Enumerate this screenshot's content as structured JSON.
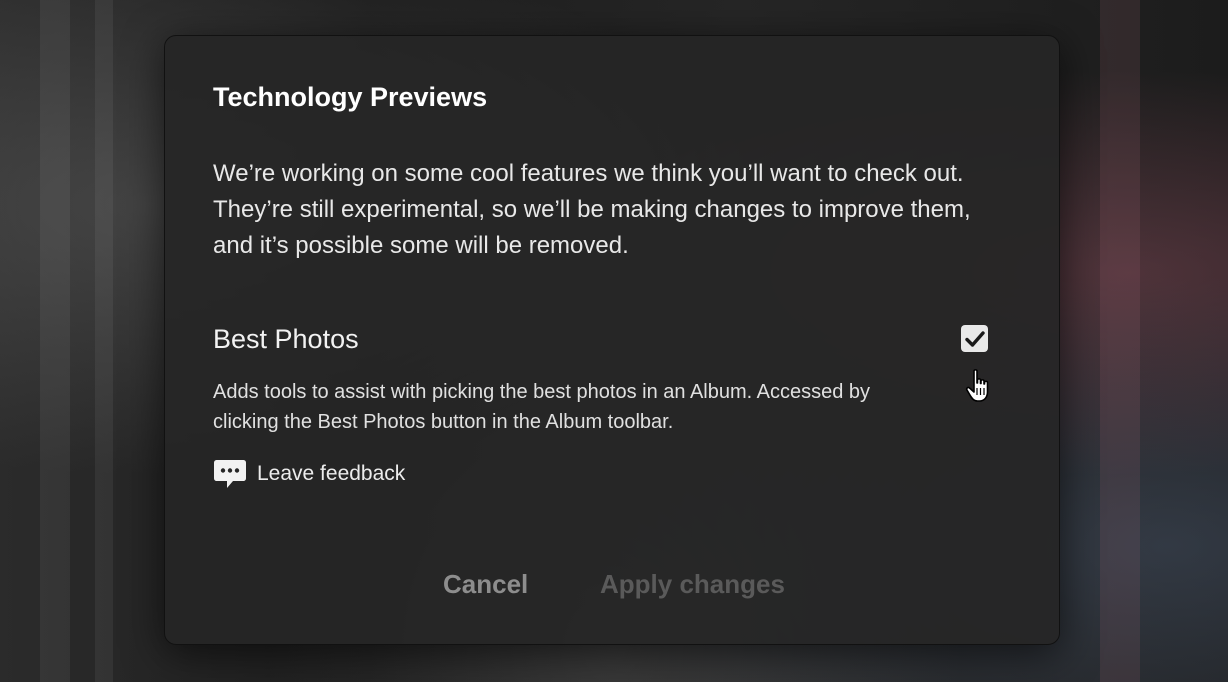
{
  "dialog": {
    "title": "Technology Previews",
    "intro": "We’re working on some cool features we think you’ll want to check out. They’re still experimental, so we’ll be making changes to improve them, and it’s possible some will be removed."
  },
  "feature": {
    "title": "Best Photos",
    "description": "Adds tools to assist with picking the best photos in an Album. Accessed by clicking the Best Photos button in the Album toolbar.",
    "enabled": true,
    "feedback_label": "Leave feedback"
  },
  "buttons": {
    "cancel_label": "Cancel",
    "apply_label": "Apply changes"
  },
  "colors": {
    "dialog_bg": "#262626",
    "text_primary": "#ffffff",
    "checkbox_bg": "#e9e9e9",
    "button_disabled": "#5a5a5a"
  },
  "icons": {
    "checkbox": "checkmark-icon",
    "feedback": "speech-bubble-icon",
    "cursor": "hand-pointer-icon"
  }
}
